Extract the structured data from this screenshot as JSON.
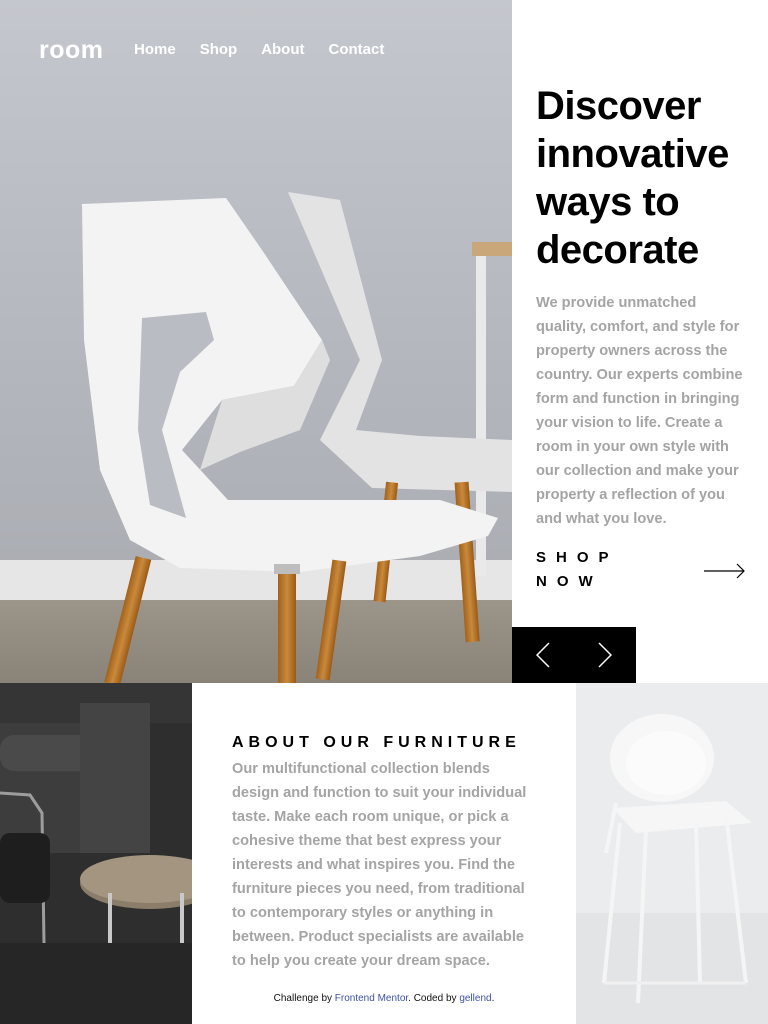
{
  "header": {
    "logo": "room",
    "nav": [
      "Home",
      "Shop",
      "About",
      "Contact"
    ]
  },
  "hero": {
    "title": "Discover innovative ways to decorate",
    "body": "We provide unmatched quality, comfort, and style for property owners across the country. Our experts combine form and function in bringing your vision to life. Create a room in your own style with our collection and make your property a reflection of you and what you love.",
    "cta": "SHOP NOW",
    "image_icon": "white-chair-photo"
  },
  "slider": {
    "prev_icon": "chevron-left-icon",
    "next_icon": "chevron-right-icon"
  },
  "about": {
    "title": "ABOUT OUR FURNITURE",
    "body": "Our multifunctional collection blends design and function to suit your individual taste. Make each room unique, or pick a cohesive theme that best express your interests and what inspires you. Find the furniture pieces you need, from traditional to contemporary styles or anything in between. Product specialists are available to help you create your dream space.",
    "dark_image_icon": "dark-interior-photo",
    "light_image_icon": "white-chair-photo"
  },
  "attribution": {
    "prefix": "Challenge by ",
    "challenge_link": "Frontend Mentor",
    "middle": ". Coded by ",
    "author_link": "gellend",
    "suffix": "."
  },
  "colors": {
    "accent": "#000000",
    "body_text": "#a4a4a4",
    "link": "#3e52a3"
  }
}
